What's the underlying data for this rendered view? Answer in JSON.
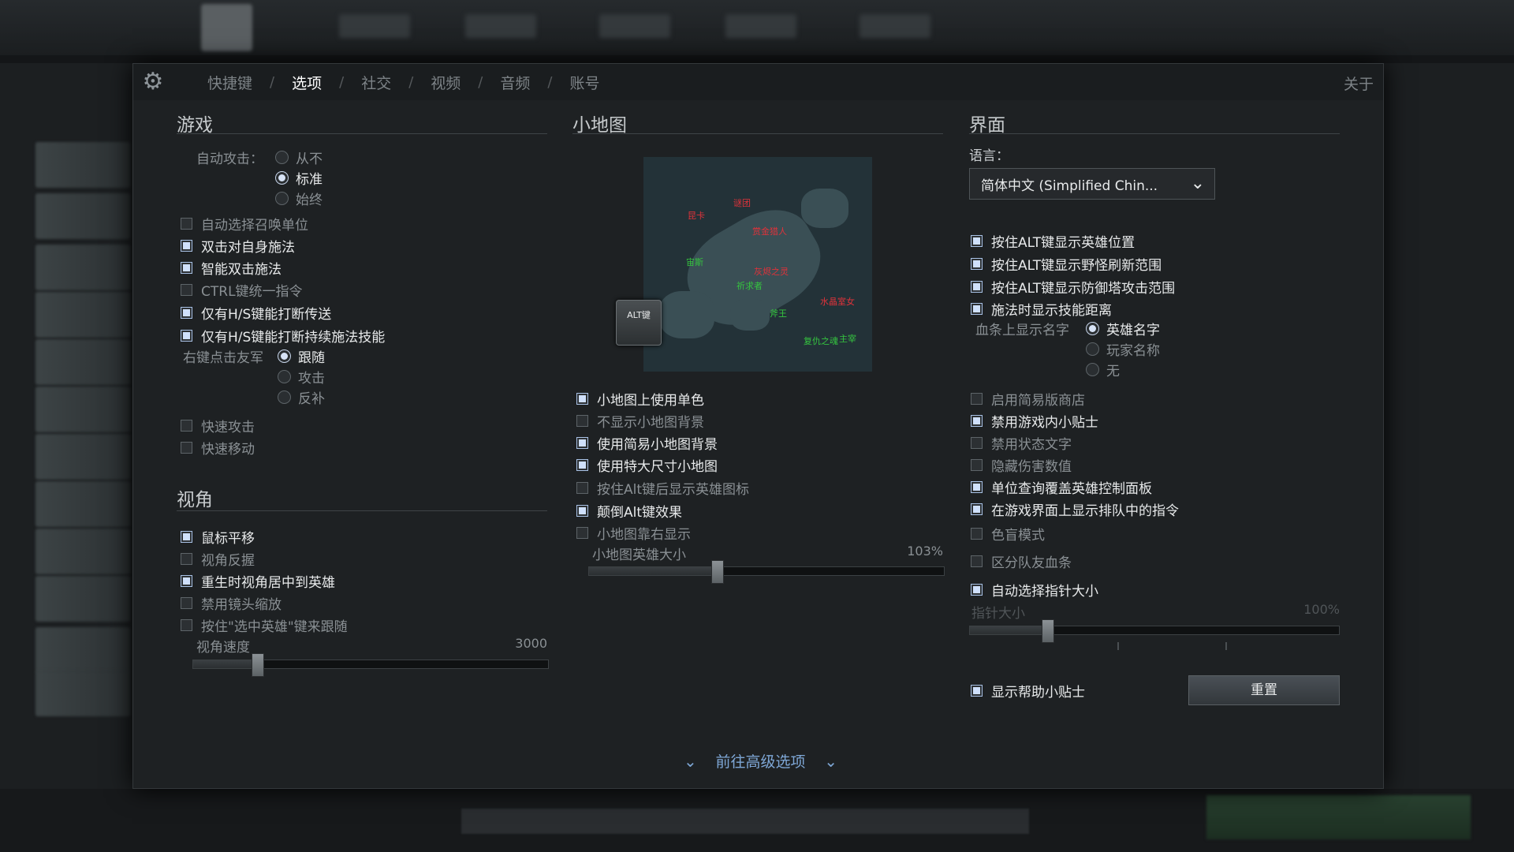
{
  "nav": {
    "tabs": [
      "快捷键",
      "选项",
      "社交",
      "视频",
      "音频",
      "账号"
    ],
    "separator": "/",
    "about": "关于"
  },
  "game": {
    "title": "游戏",
    "auto_attack_label": "自动攻击：",
    "auto_attack_options": [
      "从不",
      "标准",
      "始终"
    ],
    "auto_attack_selected": "标准",
    "checkboxes": [
      {
        "label": "自动选择召唤单位",
        "checked": false
      },
      {
        "label": "双击对自身施法",
        "checked": true
      },
      {
        "label": "智能双击施法",
        "checked": true
      },
      {
        "label": "CTRL键统一指令",
        "checked": false
      },
      {
        "label": "仅有H/S键能打断传送",
        "checked": true
      },
      {
        "label": "仅有H/S键能打断持续施法技能",
        "checked": true
      }
    ],
    "right_click_label": "右键点击友军",
    "right_click_options": [
      "跟随",
      "攻击",
      "反补"
    ],
    "right_click_selected": "跟随",
    "checkboxes2": [
      {
        "label": "快速攻击",
        "checked": false
      },
      {
        "label": "快速移动",
        "checked": false
      }
    ]
  },
  "camera": {
    "title": "视角",
    "checkboxes": [
      {
        "label": "鼠标平移",
        "checked": true
      },
      {
        "label": "视角反握",
        "checked": false
      },
      {
        "label": "重生时视角居中到英雄",
        "checked": true
      },
      {
        "label": "禁用镜头缩放",
        "checked": false
      },
      {
        "label": "按住\"选中英雄\"键来跟随",
        "checked": false
      }
    ],
    "speed_label": "视角速度",
    "speed_value": "3000",
    "speed_fraction": 0.18
  },
  "minimap": {
    "title": "小地图",
    "alt_key": "ALT键",
    "labels_red": [
      "昆卡",
      "谜团",
      "赏金猎人",
      "灰烬之灵",
      "水晶室女"
    ],
    "labels_green": [
      "宙斯",
      "祈求者",
      "斧王",
      "复仇之魂",
      "主宰"
    ],
    "checkboxes": [
      {
        "label": "小地图上使用单色",
        "checked": true
      },
      {
        "label": "不显示小地图背景",
        "checked": false
      },
      {
        "label": "使用简易小地图背景",
        "checked": true
      },
      {
        "label": "使用特大尺寸小地图",
        "checked": true
      },
      {
        "label": "按住Alt键后显示英雄图标",
        "checked": false
      },
      {
        "label": "颠倒Alt键效果",
        "checked": true
      },
      {
        "label": "小地图靠右显示",
        "checked": false
      }
    ],
    "hero_size_label": "小地图英雄大小",
    "hero_size_value": "103%",
    "hero_size_fraction": 0.36
  },
  "ui": {
    "title": "界面",
    "language_label": "语言：",
    "language_value": "简体中文 (Simplified Chin...",
    "checkboxes": [
      {
        "label": "按住ALT键显示英雄位置",
        "checked": true
      },
      {
        "label": "按住ALT键显示野怪刷新范围",
        "checked": true
      },
      {
        "label": "按住ALT键显示防御塔攻击范围",
        "checked": true
      },
      {
        "label": "施法时显示技能距离",
        "checked": true
      }
    ],
    "healthbar_label": "血条上显示名字",
    "healthbar_options": [
      "英雄名字",
      "玩家名称",
      "无"
    ],
    "healthbar_selected": "英雄名字",
    "checkboxes2": [
      {
        "label": "启用简易版商店",
        "checked": false
      },
      {
        "label": "禁用游戏内小贴士",
        "checked": true
      },
      {
        "label": "禁用状态文字",
        "checked": false
      },
      {
        "label": "隐藏伤害数值",
        "checked": false
      },
      {
        "label": "单位查询覆盖英雄控制面板",
        "checked": true
      },
      {
        "label": "在游戏界面上显示排队中的指令",
        "checked": true
      },
      {
        "label": "色盲模式",
        "checked": false
      },
      {
        "label": "区分队友血条",
        "checked": false
      },
      {
        "label": "自动选择指针大小",
        "checked": true
      }
    ],
    "cursor_size_label": "指针大小",
    "cursor_size_value": "100%",
    "cursor_size_fraction": 0.21,
    "show_tips": {
      "label": "显示帮助小贴士",
      "checked": true
    },
    "reset": "重置"
  },
  "advanced": "前往高级选项",
  "colors": {
    "accent": "#7ea7d6",
    "checkbox_on": "#cfe0fb",
    "minimap_red": "#e0323a",
    "minimap_green": "#35c43f"
  }
}
